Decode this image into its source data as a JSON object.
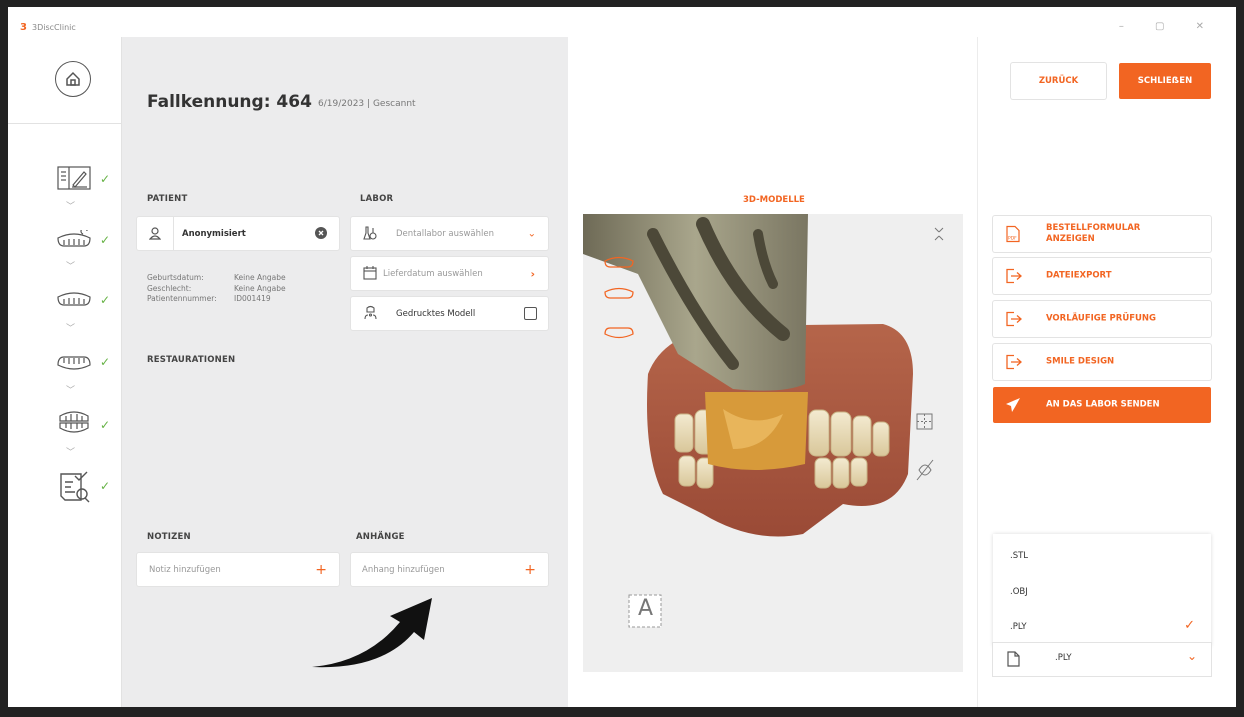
{
  "window": {
    "title": "3DiscClinic",
    "logo": "3",
    "controls": "– ▢ ✕"
  },
  "colors": {
    "accent": "#f26522",
    "check": "#66b245",
    "panel": "#ececed"
  },
  "case": {
    "title": "Fallkennung: 464",
    "date": "6/19/2023",
    "separator": "|",
    "status": "Gescannt"
  },
  "patient": {
    "section_label": "PATIENT",
    "name": "Anonymisiert",
    "details": [
      {
        "label": "Geburtsdatum:",
        "value": "Keine Angabe"
      },
      {
        "label": "Geschlecht:",
        "value": "Keine Angabe"
      },
      {
        "label": "Patientennummer:",
        "value": "ID001419"
      }
    ]
  },
  "labor": {
    "section_label": "LABOR",
    "dentallabor_placeholder": "Dentallabor auswählen",
    "lieferdatum_placeholder": "Lieferdatum auswählen",
    "printed_model_label": "Gedrucktes Modell",
    "printed_model_checked": false
  },
  "restaurationen": {
    "section_label": "RESTAURATIONEN"
  },
  "notizen": {
    "section_label": "NOTIZEN",
    "placeholder": "Notiz hinzufügen"
  },
  "anhaenge": {
    "section_label": "ANHÄNGE",
    "placeholder": "Anhang hinzufügen"
  },
  "viewer": {
    "title": "3D-MODELLE",
    "label_icon": "A"
  },
  "header_buttons": {
    "back": "ZURÜCK",
    "close": "SCHLIEẞEN"
  },
  "actions": [
    {
      "label": "BESTELLFORMULAR ANZEIGEN",
      "icon": "pdf-icon"
    },
    {
      "label": "DATEIEXPORT",
      "icon": "export-icon"
    },
    {
      "label": "VORLÄUFIGE PRÜFUNG",
      "icon": "export-icon"
    },
    {
      "label": "SMILE DESIGN",
      "icon": "export-icon"
    },
    {
      "label": "AN DAS LABOR SENDEN",
      "icon": "send-icon"
    }
  ],
  "file_format": {
    "options": [
      ".STL",
      ".OBJ",
      ".PLY"
    ],
    "selected": ".PLY"
  }
}
